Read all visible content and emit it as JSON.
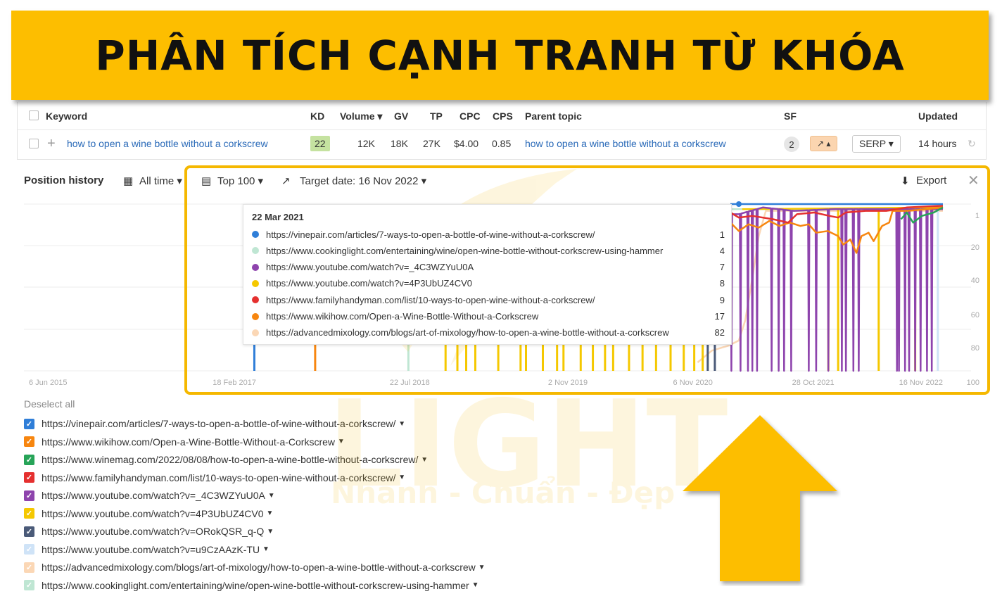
{
  "banner": {
    "title": "PHÂN TÍCH CẠNH TRANH TỪ KHÓA"
  },
  "watermark": {
    "brand": "LIGHT",
    "slogan": "Nhanh - Chuẩn - Đẹp"
  },
  "table": {
    "headers": {
      "keyword": "Keyword",
      "kd": "KD",
      "volume": "Volume ▾",
      "gv": "GV",
      "tp": "TP",
      "cpc": "CPC",
      "cps": "CPS",
      "parent": "Parent topic",
      "sf": "SF",
      "updated": "Updated"
    },
    "row": {
      "keyword": "how to open a wine bottle without a corkscrew",
      "kd": "22",
      "volume": "12K",
      "gv": "18K",
      "tp": "27K",
      "cpc": "$4.00",
      "cps": "0.85",
      "parent": "how to open a wine bottle without a corkscrew",
      "sf": "2",
      "trend": "↗ ▴",
      "serp": "SERP ▾",
      "updated": "14 hours"
    }
  },
  "panel": {
    "title": "Position history",
    "period": "All time",
    "top": "Top 100",
    "target": "Target date: 16 Nov 2022",
    "export": "Export",
    "deselect": "Deselect all"
  },
  "tooltip": {
    "date": "22 Mar 2021",
    "rows": [
      {
        "url": "https://vinepair.com/articles/7-ways-to-open-a-bottle-of-wine-without-a-corkscrew/",
        "pos": "1",
        "color": "#2f7ed8"
      },
      {
        "url": "https://www.cookinglight.com/entertaining/wine/open-wine-bottle-without-corkscrew-using-hammer",
        "pos": "4",
        "color": "#bfe6d3"
      },
      {
        "url": "https://www.youtube.com/watch?v=_4C3WZYuU0A",
        "pos": "7",
        "color": "#8e44ad"
      },
      {
        "url": "https://www.youtube.com/watch?v=4P3UbUZ4CV0",
        "pos": "8",
        "color": "#f5c800"
      },
      {
        "url": "https://www.familyhandyman.com/list/10-ways-to-open-wine-without-a-corkscrew/",
        "pos": "9",
        "color": "#e5302f"
      },
      {
        "url": "https://www.wikihow.com/Open-a-Wine-Bottle-Without-a-Corkscrew",
        "pos": "17",
        "color": "#f7860f"
      },
      {
        "url": "https://advancedmixology.com/blogs/art-of-mixology/how-to-open-a-wine-bottle-without-a-corkscrew",
        "pos": "82",
        "color": "#fbd7b5"
      }
    ]
  },
  "legend": [
    {
      "url": "https://vinepair.com/articles/7-ways-to-open-a-bottle-of-wine-without-a-corkscrew/",
      "color": "#2f7ed8"
    },
    {
      "url": "https://www.wikihow.com/Open-a-Wine-Bottle-Without-a-Corkscrew",
      "color": "#f7860f"
    },
    {
      "url": "https://www.winemag.com/2022/08/08/how-to-open-a-wine-bottle-without-a-corkscrew/",
      "color": "#27a458"
    },
    {
      "url": "https://www.familyhandyman.com/list/10-ways-to-open-wine-without-a-corkscrew/",
      "color": "#e5302f"
    },
    {
      "url": "https://www.youtube.com/watch?v=_4C3WZYuU0A",
      "color": "#8e44ad"
    },
    {
      "url": "https://www.youtube.com/watch?v=4P3UbUZ4CV0",
      "color": "#f5c800"
    },
    {
      "url": "https://www.youtube.com/watch?v=ORokQSR_q-Q",
      "color": "#4a5a78"
    },
    {
      "url": "https://www.youtube.com/watch?v=u9CzAAzK-TU",
      "color": "#cfe3f7"
    },
    {
      "url": "https://advancedmixology.com/blogs/art-of-mixology/how-to-open-a-wine-bottle-without-a-corkscrew",
      "color": "#fbd7b5"
    },
    {
      "url": "https://www.cookinglight.com/entertaining/wine/open-wine-bottle-without-corkscrew-using-hammer",
      "color": "#bfe6d3"
    }
  ],
  "chart_data": {
    "type": "line",
    "xlim": [
      "2015-06-06",
      "2022-11-16"
    ],
    "ylim": [
      1,
      100
    ],
    "y_inverted": true,
    "grid": true,
    "x_ticks": [
      "6 Jun 2015",
      "18 Feb 2017",
      "22 Jul 2018",
      "2 Nov 2019",
      "6 Nov 2020",
      "28 Oct 2021",
      "16 Nov 2022"
    ],
    "x_tick_dates": [
      "2015-06-06",
      "2017-02-18",
      "2018-07-22",
      "2019-11-02",
      "2020-11-06",
      "2021-10-28",
      "2022-11-16"
    ],
    "y_ticks": [
      1,
      20,
      40,
      60,
      80,
      100
    ],
    "hover_date": "2021-03-22",
    "series": [
      {
        "color": "#fbd7b5",
        "points": [
          [
            "2020-11-20",
            95
          ],
          [
            "2021-01-01",
            88
          ],
          [
            "2021-02-20",
            85
          ],
          [
            "2021-03-22",
            82
          ],
          [
            "2021-04-10",
            70
          ],
          [
            "2021-05-01",
            45
          ],
          [
            "2021-05-20",
            20
          ],
          [
            "2021-06-10",
            5
          ],
          [
            "2022-11-16",
            5
          ]
        ],
        "spikes": []
      },
      {
        "color": "#bfe6d3",
        "points": [
          [
            "2021-02-25",
            4
          ],
          [
            "2021-03-22",
            4
          ],
          [
            "2022-11-16",
            4
          ]
        ],
        "spikes": [
          "2018-07-18"
        ]
      },
      {
        "color": "#f5c800",
        "points": [
          [
            "2021-04-01",
            4
          ],
          [
            "2022-11-16",
            3
          ]
        ],
        "spikes": [
          "2018-11-05",
          "2018-12-10",
          "2019-01-05",
          "2019-02-01",
          "2019-04-10",
          "2019-06-15",
          "2019-07-01",
          "2019-08-20",
          "2019-10-01",
          "2019-10-20",
          "2019-12-10",
          "2020-01-15",
          "2020-02-20",
          "2020-03-15",
          "2020-05-01",
          "2020-06-10",
          "2020-07-20",
          "2020-09-01",
          "2020-10-10",
          "2020-11-10",
          "2020-12-05",
          "2021-12-12",
          "2022-01-10",
          "2022-05-10",
          "2022-08-26"
        ]
      },
      {
        "color": "#4a5a78",
        "points": [],
        "spikes": [
          "2020-12-20",
          "2021-01-10"
        ]
      },
      {
        "color": "#cfe3f7",
        "points": [],
        "spikes": [
          "2022-11-01"
        ]
      },
      {
        "color": "#8e44ad",
        "points": [
          [
            "2021-02-25",
            7
          ],
          [
            "2021-03-22",
            7
          ],
          [
            "2021-06-01",
            3
          ],
          [
            "2021-09-01",
            5
          ],
          [
            "2022-01-01",
            4
          ],
          [
            "2022-11-16",
            4
          ]
        ],
        "drops": [
          "2021-02-28",
          "2021-03-27",
          "2021-04-18",
          "2021-05-01",
          "2021-05-15",
          "2021-06-27",
          "2021-07-18",
          "2021-08-03",
          "2021-08-24",
          "2021-10-15",
          "2021-11-06",
          "2021-12-12",
          "2022-01-21",
          "2022-02-02",
          "2022-02-24",
          "2022-03-12",
          "2022-07-03",
          "2022-07-09",
          "2022-07-27",
          "2022-08-08",
          "2022-08-26",
          "2022-09-11",
          "2022-09-30",
          "2022-10-14"
        ],
        "spikes": []
      },
      {
        "color": "#f7860f",
        "points": [
          [
            "2021-02-25",
            12
          ],
          [
            "2021-03-22",
            17
          ],
          [
            "2021-04-20",
            13
          ],
          [
            "2021-05-20",
            15
          ],
          [
            "2021-06-20",
            11
          ],
          [
            "2021-07-20",
            14
          ],
          [
            "2021-08-20",
            12
          ],
          [
            "2021-09-20",
            14
          ],
          [
            "2021-10-15",
            13
          ],
          [
            "2021-11-06",
            18
          ],
          [
            "2021-12-10",
            17
          ],
          [
            "2022-01-10",
            20
          ],
          [
            "2022-01-25",
            25
          ],
          [
            "2022-02-15",
            22
          ],
          [
            "2022-03-05",
            30
          ],
          [
            "2022-03-20",
            20
          ],
          [
            "2022-04-10",
            18
          ],
          [
            "2022-04-25",
            23
          ],
          [
            "2022-05-20",
            14
          ],
          [
            "2022-06-10",
            12
          ],
          [
            "2022-06-20",
            5
          ],
          [
            "2022-08-01",
            5
          ],
          [
            "2022-10-01",
            4
          ],
          [
            "2022-11-16",
            3
          ]
        ],
        "spikes": [
          "2017-10-15"
        ]
      },
      {
        "color": "#e5302f",
        "points": [
          [
            "2021-02-25",
            6
          ],
          [
            "2021-03-22",
            9
          ],
          [
            "2021-05-01",
            8
          ],
          [
            "2021-07-01",
            10
          ],
          [
            "2021-08-15",
            12
          ],
          [
            "2021-09-10",
            7
          ],
          [
            "2021-11-01",
            6
          ],
          [
            "2021-12-15",
            8
          ],
          [
            "2022-01-10",
            9
          ],
          [
            "2022-02-01",
            6
          ],
          [
            "2022-04-01",
            5
          ],
          [
            "2022-06-01",
            5
          ],
          [
            "2022-08-01",
            3
          ],
          [
            "2022-11-16",
            2
          ]
        ],
        "spikes": []
      },
      {
        "color": "#27a458",
        "points": [
          [
            "2022-07-15",
            10
          ],
          [
            "2022-08-01",
            6
          ],
          [
            "2022-08-20",
            12
          ],
          [
            "2022-09-15",
            8
          ],
          [
            "2022-10-20",
            6
          ],
          [
            "2022-11-16",
            3
          ]
        ],
        "spikes": []
      },
      {
        "color": "#2f7ed8",
        "points": [
          [
            "2021-02-25",
            1
          ],
          [
            "2022-11-16",
            1
          ]
        ],
        "spikes": [
          "2017-04-18"
        ]
      }
    ]
  }
}
